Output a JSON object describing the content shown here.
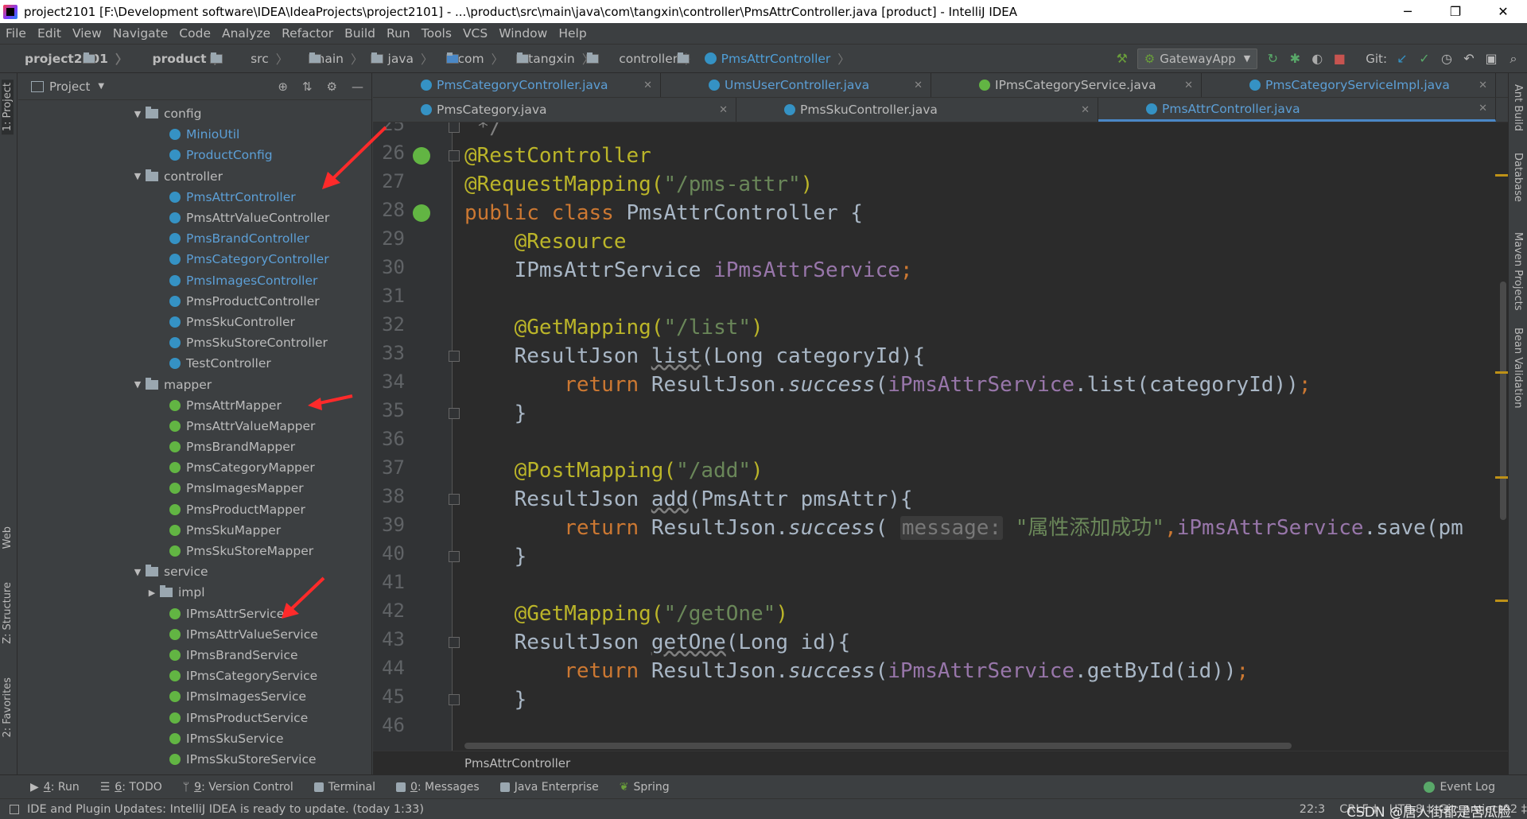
{
  "window": {
    "title": "project2101 [F:\\Development software\\IDEA\\IdeaProjects\\project2101] - ...\\product\\src\\main\\java\\com\\tangxin\\controller\\PmsAttrController.java [product] - IntelliJ IDEA",
    "minimize": "─",
    "restore": "❐",
    "close": "✕"
  },
  "menu": [
    "File",
    "Edit",
    "View",
    "Navigate",
    "Code",
    "Analyze",
    "Refactor",
    "Build",
    "Run",
    "Tools",
    "VCS",
    "Window",
    "Help"
  ],
  "breadcrumbs": [
    "project2101",
    "product",
    "src",
    "main",
    "java",
    "com",
    "tangxin",
    "controller",
    "PmsAttrController"
  ],
  "toolbar": {
    "run_config": "GatewayApp",
    "git_label": "Git:"
  },
  "project_panel": {
    "title": "Project",
    "tree": [
      {
        "label": "config",
        "type": "folder",
        "expanded": true,
        "indent": 1
      },
      {
        "label": "MinioUtil",
        "type": "class",
        "indent": 2,
        "blue": true
      },
      {
        "label": "ProductConfig",
        "type": "class",
        "indent": 2,
        "blue": true
      },
      {
        "label": "controller",
        "type": "folder",
        "expanded": true,
        "indent": 1
      },
      {
        "label": "PmsAttrController",
        "type": "class",
        "indent": 2,
        "blue": true
      },
      {
        "label": "PmsAttrValueController",
        "type": "class",
        "indent": 2
      },
      {
        "label": "PmsBrandController",
        "type": "class",
        "indent": 2,
        "blue": true
      },
      {
        "label": "PmsCategoryController",
        "type": "class",
        "indent": 2,
        "blue": true
      },
      {
        "label": "PmsImagesController",
        "type": "class",
        "indent": 2,
        "blue": true
      },
      {
        "label": "PmsProductController",
        "type": "class",
        "indent": 2
      },
      {
        "label": "PmsSkuController",
        "type": "class",
        "indent": 2
      },
      {
        "label": "PmsSkuStoreController",
        "type": "class",
        "indent": 2
      },
      {
        "label": "TestController",
        "type": "class",
        "indent": 2
      },
      {
        "label": "mapper",
        "type": "folder",
        "expanded": true,
        "indent": 1
      },
      {
        "label": "PmsAttrMapper",
        "type": "interface",
        "indent": 2
      },
      {
        "label": "PmsAttrValueMapper",
        "type": "interface",
        "indent": 2
      },
      {
        "label": "PmsBrandMapper",
        "type": "interface",
        "indent": 2
      },
      {
        "label": "PmsCategoryMapper",
        "type": "interface",
        "indent": 2
      },
      {
        "label": "PmsImagesMapper",
        "type": "interface",
        "indent": 2
      },
      {
        "label": "PmsProductMapper",
        "type": "interface",
        "indent": 2
      },
      {
        "label": "PmsSkuMapper",
        "type": "interface",
        "indent": 2
      },
      {
        "label": "PmsSkuStoreMapper",
        "type": "interface",
        "indent": 2
      },
      {
        "label": "service",
        "type": "folder",
        "expanded": true,
        "indent": 1
      },
      {
        "label": "impl",
        "type": "folder",
        "expanded": false,
        "indent": 2
      },
      {
        "label": "IPmsAttrService",
        "type": "interface",
        "indent": 2
      },
      {
        "label": "IPmsAttrValueService",
        "type": "interface",
        "indent": 2
      },
      {
        "label": "IPmsBrandService",
        "type": "interface",
        "indent": 2
      },
      {
        "label": "IPmsCategoryService",
        "type": "interface",
        "indent": 2
      },
      {
        "label": "IPmsImagesService",
        "type": "interface",
        "indent": 2
      },
      {
        "label": "IPmsProductService",
        "type": "interface",
        "indent": 2
      },
      {
        "label": "IPmsSkuService",
        "type": "interface",
        "indent": 2
      },
      {
        "label": "IPmsSkuStoreService",
        "type": "interface",
        "indent": 2
      }
    ]
  },
  "editor_tabs": {
    "row1": [
      {
        "label": "PmsCategoryController.java",
        "type": "class",
        "blue": true
      },
      {
        "label": "UmsUserController.java",
        "type": "class",
        "blue": true
      },
      {
        "label": "IPmsCategoryService.java",
        "type": "interface"
      },
      {
        "label": "PmsCategoryServiceImpl.java",
        "type": "class",
        "blue": true
      }
    ],
    "row2": [
      {
        "label": "PmsCategory.java",
        "type": "class"
      },
      {
        "label": "PmsSkuController.java",
        "type": "class"
      },
      {
        "label": "PmsAttrController.java",
        "type": "class",
        "active": true
      }
    ]
  },
  "editor": {
    "line_numbers": [
      "25",
      "26",
      "27",
      "28",
      "29",
      "30",
      "31",
      "32",
      "33",
      "34",
      "35",
      "36",
      "37",
      "38",
      "39",
      "40",
      "41",
      "42",
      "43",
      "44",
      "45",
      "46"
    ],
    "breadcrumb": "PmsAttrController",
    "code": {
      "l25": " */",
      "l26_a": "@RestController",
      "l27_a": "@RequestMapping(",
      "l27_s": "\"/pms-attr\"",
      "l27_b": ")",
      "l28_k": "public class ",
      "l28_t": "PmsAttrController {",
      "l29_a": "    @Resource",
      "l30_t": "    IPmsAttrService ",
      "l30_f": "iPmsAttrService",
      "l30_k": ";",
      "l32_a": "    @GetMapping(",
      "l32_s": "\"/list\"",
      "l32_b": ")",
      "l33_t1": "    ResultJson ",
      "l33_m": "list",
      "l33_t2": "(Long categoryId){",
      "l34_k": "        return ",
      "l34_t1": "ResultJson.",
      "l34_i": "success",
      "l34_t2": "(",
      "l34_f": "iPmsAttrService",
      "l34_t3": ".list(categoryId))",
      "l34_k2": ";",
      "l35": "    }",
      "l37_a": "    @PostMapping(",
      "l37_s": "\"/add\"",
      "l37_b": ")",
      "l38_t1": "    ResultJson ",
      "l38_m": "add",
      "l38_t2": "(PmsAttr pmsAttr){",
      "l39_k": "        return ",
      "l39_t1": "ResultJson.",
      "l39_i": "success",
      "l39_t2": "( ",
      "l39_h": "message:",
      "l39_s": " \"属性添加成功\"",
      "l39_k2": ",",
      "l39_f": "iPmsAttrService",
      "l39_t3": ".save(pm",
      "l40": "    }",
      "l42_a": "    @GetMapping(",
      "l42_s": "\"/getOne\"",
      "l42_b": ")",
      "l43_t1": "    ResultJson ",
      "l43_m": "getOne",
      "l43_t2": "(Long id){",
      "l44_k": "        return ",
      "l44_t1": "ResultJson.",
      "l44_i": "success",
      "l44_t2": "(",
      "l44_f": "iPmsAttrService",
      "l44_t3": ".getById(id))",
      "l44_k2": ";",
      "l45": "    }"
    }
  },
  "right_tools": [
    "Ant Build",
    "Database",
    "Maven Projects",
    "Bean Validation"
  ],
  "left_tools": [
    "1: Project",
    "Web",
    "Z: Structure",
    "2: Favorites"
  ],
  "bottom_tools": [
    {
      "key": "4",
      "label": ": Run"
    },
    {
      "key": "6",
      "label": ": TODO"
    },
    {
      "key": "9",
      "label": ": Version Control"
    },
    {
      "key": "",
      "label": "Terminal"
    },
    {
      "key": "0",
      "label": ": Messages"
    },
    {
      "key": "",
      "label": "Java Enterprise"
    },
    {
      "key": "",
      "label": "Spring"
    }
  ],
  "event_log": "Event Log",
  "status": {
    "message": "IDE and Plugin Updates: IntelliJ IDEA is ready to update. (today 1:33)",
    "position": "22:3",
    "line_sep": "CRLF ‡",
    "encoding": "UTF-8 ‡",
    "git": "Git: project02 ‡",
    "watermark": "CSDN @唐人街都是苦瓜脸"
  }
}
